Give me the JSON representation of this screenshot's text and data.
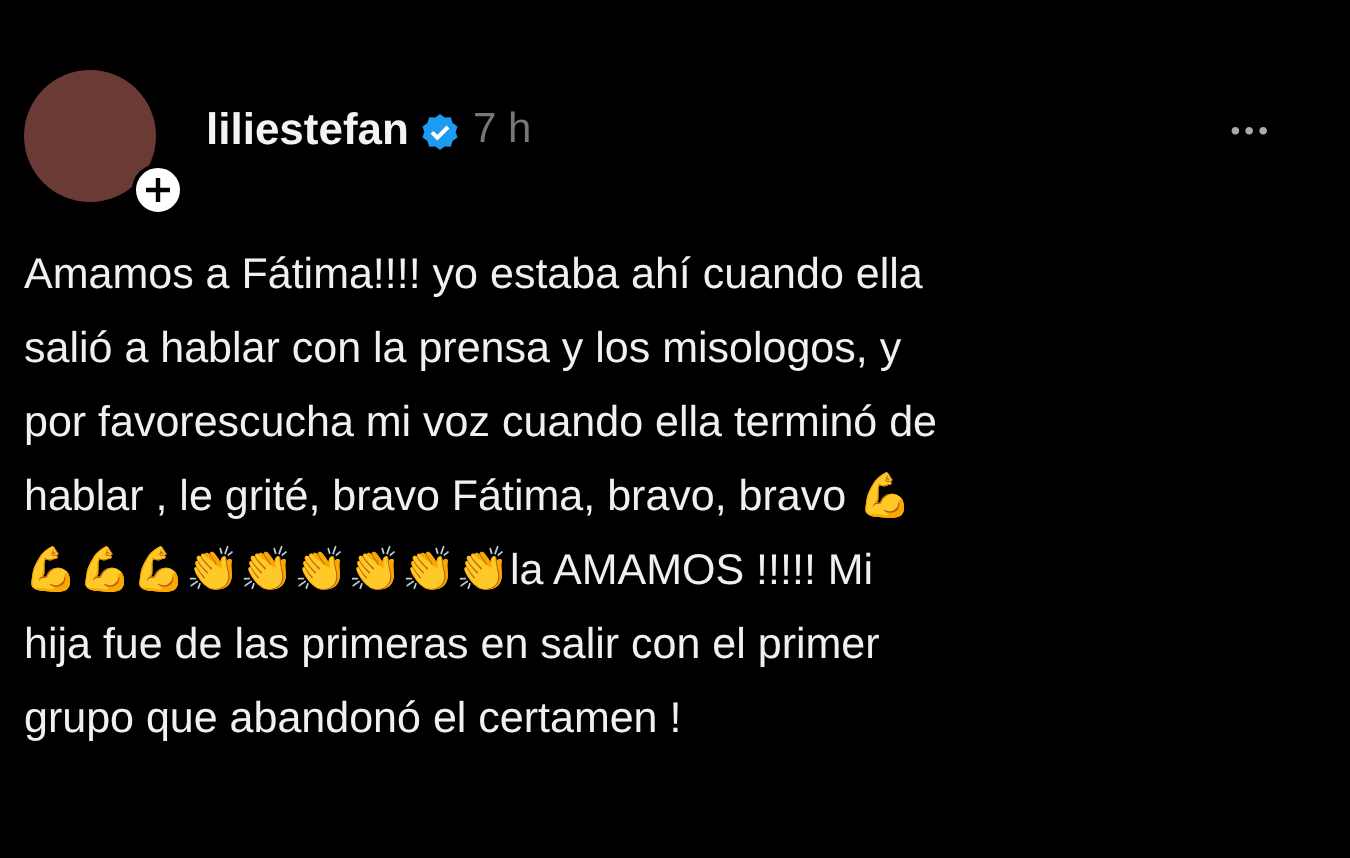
{
  "post": {
    "username": "liliestefan",
    "verified": true,
    "time": "7 h",
    "more": "•••",
    "text": "Amamos a Fátima!!!! yo estaba ahí cuando ella\nsalió a hablar con la prensa y los misologos, y\npor favorescucha mi voz cuando ella terminó de\nhablar , le grité, bravo Fátima, bravo, bravo 💪\n💪💪💪👏👏👏👏👏👏la AMAMOS !!!!! Mi\nhija fue de las primeras en salir con el primer\ngrupo que abandonó el certamen !"
  }
}
